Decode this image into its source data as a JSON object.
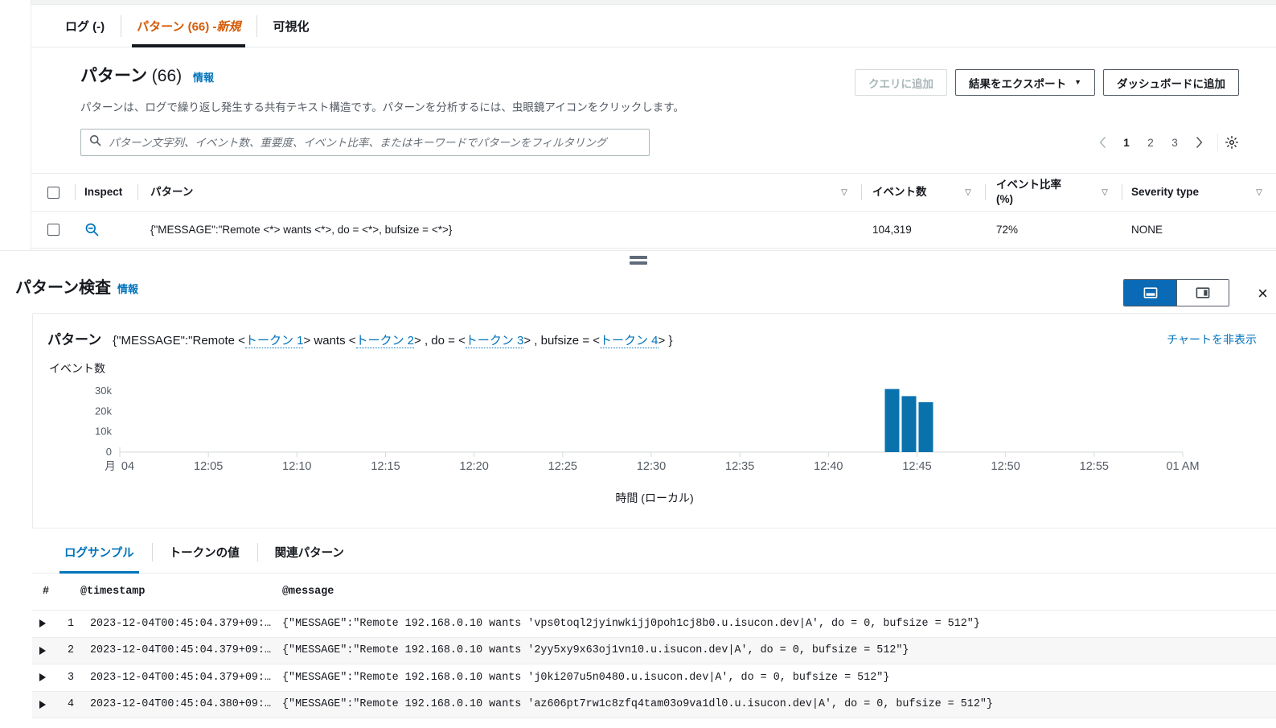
{
  "tabs": [
    {
      "label": "ログ (-)",
      "active": false
    },
    {
      "label": "パターン (66) - ",
      "badge": "新規",
      "active": true
    },
    {
      "label": "可視化",
      "active": false
    }
  ],
  "results": {
    "title": "パターン",
    "count": "(66)",
    "info": "情報",
    "description": "パターンは、ログで繰り返し発生する共有テキスト構造です。パターンを分析するには、虫眼鏡アイコンをクリックします。",
    "buttons": {
      "add_to_query": "クエリに追加",
      "export_results": "結果をエクスポート",
      "export_caret": "▼",
      "add_to_dashboard": "ダッシュボードに追加"
    },
    "filter": {
      "placeholder": "パターン文字列、イベント数、重要度、イベント比率、またはキーワードでパターンをフィルタリング",
      "value": "",
      "icon": "search-icon"
    },
    "pagination": {
      "prev": "‹",
      "pages": [
        "1",
        "2",
        "3"
      ],
      "current": "1",
      "next": "›",
      "settings_icon": "gear-icon"
    },
    "columns": {
      "inspect": "Inspect",
      "pattern": "パターン",
      "event_count": "イベント数",
      "event_ratio": "イベント比率\n(%)",
      "event_ratio_l1": "イベント比率",
      "event_ratio_l2": "(%)",
      "severity": "Severity type",
      "sort_caret": "▽"
    },
    "rows": [
      {
        "pattern": "{\"MESSAGE\":\"Remote <*> wants <*>, do = <*>, bufsize = <*>}",
        "event_count": "104,319",
        "event_ratio": "72%",
        "severity": "NONE"
      }
    ]
  },
  "splitter": {
    "name": "resize-handle"
  },
  "inspect": {
    "title": "パターン検査",
    "info": "情報",
    "layout_toggle": {
      "bottom_split": "bottom-split-icon",
      "side_split": "side-split-icon",
      "active": "bottom_split"
    },
    "close": "×",
    "pattern_label": "パターン",
    "pattern_parts": [
      {
        "type": "text",
        "text": "{\"MESSAGE\":\"Remote <"
      },
      {
        "type": "token",
        "text": "トークン 1"
      },
      {
        "type": "text",
        "text": "> wants <"
      },
      {
        "type": "token",
        "text": "トークン 2"
      },
      {
        "type": "text",
        "text": "> , do = <"
      },
      {
        "type": "token",
        "text": "トークン 3"
      },
      {
        "type": "text",
        "text": "> , bufsize = <"
      },
      {
        "type": "token",
        "text": "トークン 4"
      },
      {
        "type": "text",
        "text": "> }"
      }
    ],
    "hide_chart": "チャートを非表示",
    "sub_tabs": [
      {
        "label": "ログサンプル",
        "active": true
      },
      {
        "label": "トークンの値",
        "active": false
      },
      {
        "label": "関連パターン",
        "active": false
      }
    ],
    "log_columns": {
      "index": "#",
      "timestamp": "@timestamp",
      "message": "@message"
    },
    "log_rows": [
      {
        "n": "1",
        "timestamp": "2023-12-04T00:45:04.379+09:…",
        "message": "{\"MESSAGE\":\"Remote 192.168.0.10 wants 'vps0toql2jyinwkijj0poh1cj8b0.u.isucon.dev|A', do = 0, bufsize = 512\"}"
      },
      {
        "n": "2",
        "timestamp": "2023-12-04T00:45:04.379+09:…",
        "message": "{\"MESSAGE\":\"Remote 192.168.0.10 wants '2yy5xy9x63oj1vn10.u.isucon.dev|A', do = 0, bufsize = 512\"}"
      },
      {
        "n": "3",
        "timestamp": "2023-12-04T00:45:04.379+09:…",
        "message": "{\"MESSAGE\":\"Remote 192.168.0.10 wants 'j0ki207u5n0480.u.isucon.dev|A', do = 0, bufsize = 512\"}"
      },
      {
        "n": "4",
        "timestamp": "2023-12-04T00:45:04.380+09:…",
        "message": "{\"MESSAGE\":\"Remote 192.168.0.10 wants 'az606pt7rw1c8zfq4tam03o9va1dl0.u.isucon.dev|A', do = 0, bufsize = 512\"}"
      }
    ]
  },
  "colors": {
    "accent_orange": "#d45b07",
    "link_blue": "#0073bb",
    "bar_blue": "#0972ac",
    "toggle_active": "#0a6ab5",
    "border": "#e9ebed",
    "text": "#16191f",
    "muted": "#545b64"
  },
  "chart_data": {
    "type": "bar",
    "title": "",
    "ylabel": "イベント数",
    "xlabel": "時間 (ローカル)",
    "ytick_labels": [
      "0",
      "10k",
      "20k",
      "30k"
    ],
    "ytick_values": [
      0,
      10000,
      20000,
      30000
    ],
    "ylim": [
      0,
      34000
    ],
    "grid": false,
    "xtick_labels": [
      "月 04",
      "12:05",
      "12:10",
      "12:15",
      "12:20",
      "12:25",
      "12:30",
      "12:35",
      "12:40",
      "12:45",
      "12:50",
      "12:55",
      "01 AM"
    ],
    "x": [
      "12:43",
      "12:44",
      "12:45"
    ],
    "values": [
      31000,
      27500,
      24500
    ],
    "bar_color": "#0972ac",
    "legend": null
  }
}
